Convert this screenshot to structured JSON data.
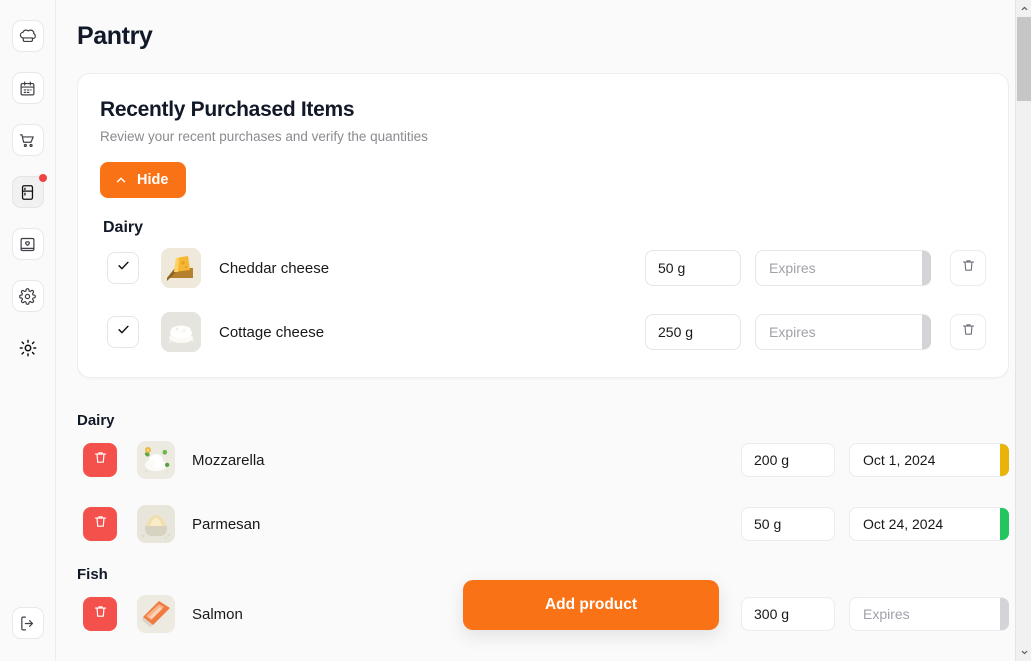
{
  "app": {
    "accent_orange": "#f97316",
    "danger_red": "#f4504c",
    "status_amber": "#eab308",
    "status_green": "#22c55e",
    "page_bg": "#fafafa"
  },
  "sidebar": {
    "items": [
      {
        "name": "chef-hat-icon",
        "label": "Recipes",
        "active": false,
        "badge": false
      },
      {
        "name": "calendar-icon",
        "label": "Meal plan",
        "active": false,
        "badge": false
      },
      {
        "name": "shopping-cart-icon",
        "label": "Shopping list",
        "active": false,
        "badge": false
      },
      {
        "name": "fridge-icon",
        "label": "Pantry",
        "active": true,
        "badge": true
      },
      {
        "name": "cookbook-icon",
        "label": "Cookbook",
        "active": false,
        "badge": false
      },
      {
        "name": "gear-icon",
        "label": "Settings",
        "active": false,
        "badge": false
      },
      {
        "name": "sun-icon",
        "label": "Theme",
        "active": false,
        "badge": false
      }
    ],
    "logout": {
      "name": "logout-icon",
      "label": "Log out"
    }
  },
  "header": {
    "title": "Pantry"
  },
  "recent_card": {
    "title": "Recently Purchased Items",
    "subtitle": "Review your recent purchases and verify the quantities",
    "toggle_button": {
      "label": "Hide",
      "icon": "chevron-up-icon"
    },
    "group_label": "Dairy",
    "delete_icon": "trash-icon",
    "check_icon": "check-icon",
    "items": [
      {
        "name": "Cheddar cheese",
        "thumb": "cheddar-cheese-image",
        "checked": true,
        "quantity": "50 g",
        "expires_value": "",
        "expires_placeholder": "Expires"
      },
      {
        "name": "Cottage cheese",
        "thumb": "cottage-cheese-image",
        "checked": true,
        "quantity": "250 g",
        "expires_value": "",
        "expires_placeholder": "Expires"
      }
    ]
  },
  "pantry_list": {
    "delete_icon": "trash-icon",
    "expires_placeholder": "Expires",
    "groups": [
      {
        "label": "Dairy",
        "items": [
          {
            "name": "Mozzarella",
            "thumb": "mozzarella-image",
            "quantity": "200 g",
            "expires": "Oct 1, 2024",
            "status_color": "#eab308"
          },
          {
            "name": "Parmesan",
            "thumb": "parmesan-image",
            "quantity": "50 g",
            "expires": "Oct 24, 2024",
            "status_color": "#22c55e"
          }
        ]
      },
      {
        "label": "Fish",
        "items": [
          {
            "name": "Salmon",
            "thumb": "salmon-image",
            "quantity": "300 g",
            "expires": "",
            "status_color": "#d4d4d8"
          }
        ]
      }
    ]
  },
  "floating": {
    "add_product_label": "Add product"
  },
  "scrollbar": {
    "up_icon": "chevron-up-icon",
    "down_icon": "chevron-down-icon"
  }
}
